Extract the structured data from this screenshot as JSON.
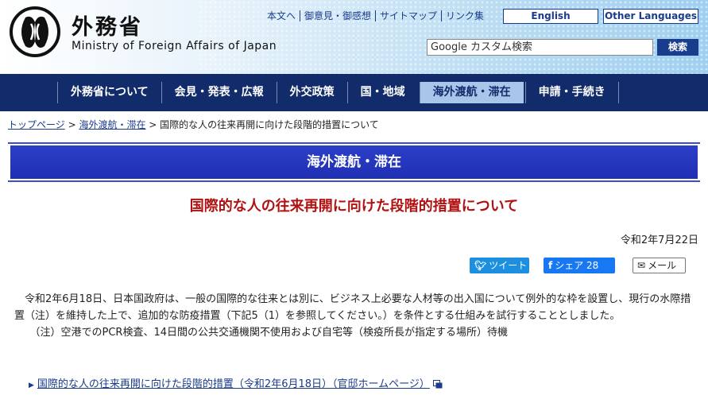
{
  "header": {
    "site_title": "外務省",
    "site_subtitle": "Ministry of Foreign Affairs of Japan",
    "util_links": [
      "本文へ",
      "御意見・御感想",
      "サイトマップ",
      "リンク集"
    ],
    "lang_english": "English",
    "lang_other": "Other Languages",
    "search_placeholder": "Google カスタム検索",
    "search_button": "検索"
  },
  "nav": {
    "items": [
      "外務省について",
      "会見・発表・広報",
      "外交政策",
      "国・地域",
      "海外渡航・滞在",
      "申請・手続き"
    ],
    "active_index": 4
  },
  "breadcrumb": {
    "home": "トップページ",
    "sep1": " > ",
    "section": "海外渡航・滞在",
    "sep2": " > ",
    "current": "国際的な人の往来再開に向けた段階的措置について"
  },
  "section_bar": "海外渡航・滞在",
  "page_title": "国際的な人の往来再開に向けた段階的措置について",
  "date": "令和2年7月22日",
  "share": {
    "tweet_label": "ツイート",
    "facebook_label": "シェア 28",
    "mail_label": "メール"
  },
  "body": {
    "paragraph1": "令和2年6月18日、日本国政府は、一般の国際的な往来とは別に、ビジネス上必要な人材等の出入国について例外的な枠を設置し、現行の水際措置（注）を維持した上で、追加的な防疫措置（下記5（1）を参照してください。）を条件とする仕組みを試行することとしました。",
    "note": "（注）空港でのPCR検査、14日間の公共交通機関不使用および自宅等（検疫所長が指定する場所）待機"
  },
  "reference_link": "国際的な人の往来再開に向けた段階的措置（令和2年6月18日）（官邸ホームページ）",
  "colors": {
    "nav_bg": "#122c6b",
    "section_bar": "#2b3fc7",
    "title_red": "#b01212",
    "link_blue": "#1a3c8c"
  }
}
